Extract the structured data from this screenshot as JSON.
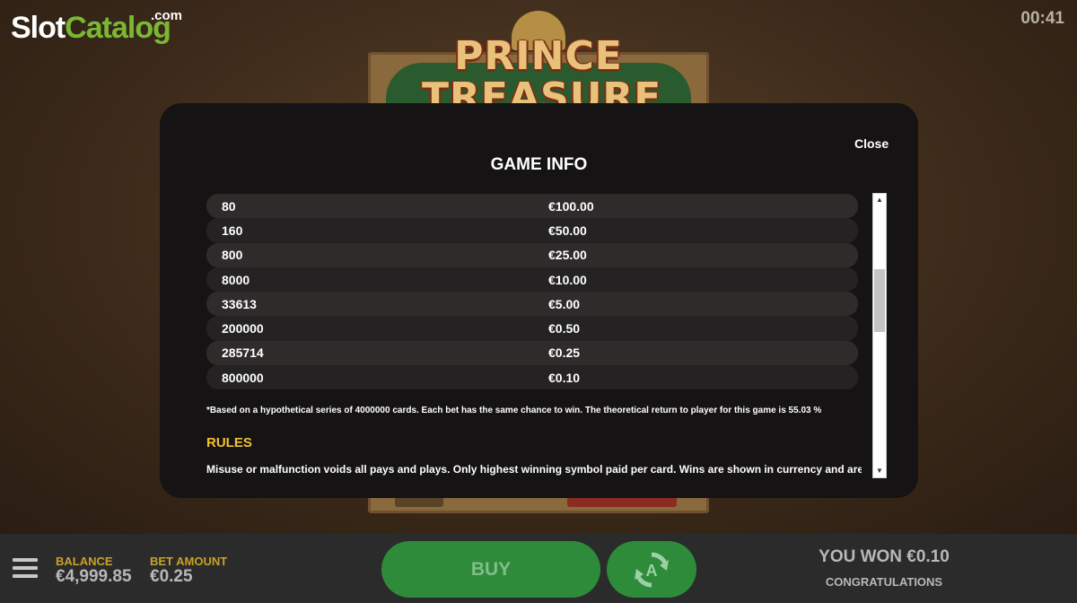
{
  "site_logo": {
    "slot": "Slot",
    "catalog": "Catalog",
    "com": ".com"
  },
  "timer": "00:41",
  "game_logo": {
    "line1": "PRINCE",
    "line2": "TREASURE"
  },
  "modal": {
    "title": "GAME INFO",
    "close_label": "Close",
    "pay_table": [
      {
        "odds": "80",
        "prize": "€100.00"
      },
      {
        "odds": "160",
        "prize": "€50.00"
      },
      {
        "odds": "800",
        "prize": "€25.00"
      },
      {
        "odds": "8000",
        "prize": "€10.00"
      },
      {
        "odds": "33613",
        "prize": "€5.00"
      },
      {
        "odds": "200000",
        "prize": "€0.50"
      },
      {
        "odds": "285714",
        "prize": "€0.25"
      },
      {
        "odds": "800000",
        "prize": "€0.10"
      }
    ],
    "footnote": "*Based on a hypothetical series of 4000000 cards. Each bet has the same chance to win. The theoretical return to player for this game is 55.03 %",
    "rules_title": "RULES",
    "rules_text": "Misuse or malfunction voids all pays and plays. Only highest winning symbol paid per card. Wins are shown in currency and are"
  },
  "bottom_bar": {
    "balance_label": "BALANCE",
    "balance_value": "€4,999.85",
    "bet_label": "BET AMOUNT",
    "bet_value": "€0.25",
    "buy_label": "BUY",
    "won_text": "YOU WON €0.10",
    "congrats_text": "CONGRATULATIONS"
  },
  "colors": {
    "accent_gold": "#c9a227",
    "button_green": "#2e8b3a",
    "rules_yellow": "#f2c233"
  },
  "icons": [
    "menu-icon",
    "autoplay-icon",
    "scroll-up-icon",
    "scroll-down-icon"
  ]
}
